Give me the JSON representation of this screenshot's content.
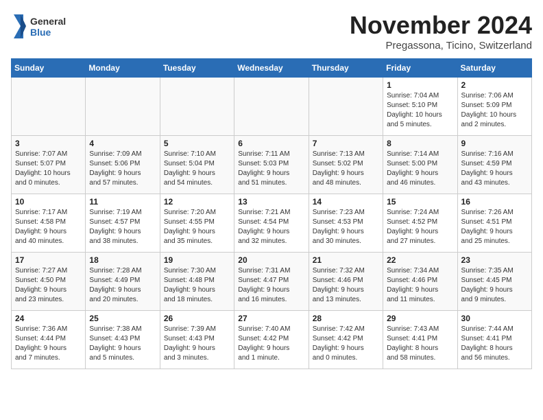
{
  "header": {
    "logo_general": "General",
    "logo_blue": "Blue",
    "month": "November 2024",
    "location": "Pregassona, Ticino, Switzerland"
  },
  "weekdays": [
    "Sunday",
    "Monday",
    "Tuesday",
    "Wednesday",
    "Thursday",
    "Friday",
    "Saturday"
  ],
  "weeks": [
    [
      {
        "day": "",
        "info": ""
      },
      {
        "day": "",
        "info": ""
      },
      {
        "day": "",
        "info": ""
      },
      {
        "day": "",
        "info": ""
      },
      {
        "day": "",
        "info": ""
      },
      {
        "day": "1",
        "info": "Sunrise: 7:04 AM\nSunset: 5:10 PM\nDaylight: 10 hours\nand 5 minutes."
      },
      {
        "day": "2",
        "info": "Sunrise: 7:06 AM\nSunset: 5:09 PM\nDaylight: 10 hours\nand 2 minutes."
      }
    ],
    [
      {
        "day": "3",
        "info": "Sunrise: 7:07 AM\nSunset: 5:07 PM\nDaylight: 10 hours\nand 0 minutes."
      },
      {
        "day": "4",
        "info": "Sunrise: 7:09 AM\nSunset: 5:06 PM\nDaylight: 9 hours\nand 57 minutes."
      },
      {
        "day": "5",
        "info": "Sunrise: 7:10 AM\nSunset: 5:04 PM\nDaylight: 9 hours\nand 54 minutes."
      },
      {
        "day": "6",
        "info": "Sunrise: 7:11 AM\nSunset: 5:03 PM\nDaylight: 9 hours\nand 51 minutes."
      },
      {
        "day": "7",
        "info": "Sunrise: 7:13 AM\nSunset: 5:02 PM\nDaylight: 9 hours\nand 48 minutes."
      },
      {
        "day": "8",
        "info": "Sunrise: 7:14 AM\nSunset: 5:00 PM\nDaylight: 9 hours\nand 46 minutes."
      },
      {
        "day": "9",
        "info": "Sunrise: 7:16 AM\nSunset: 4:59 PM\nDaylight: 9 hours\nand 43 minutes."
      }
    ],
    [
      {
        "day": "10",
        "info": "Sunrise: 7:17 AM\nSunset: 4:58 PM\nDaylight: 9 hours\nand 40 minutes."
      },
      {
        "day": "11",
        "info": "Sunrise: 7:19 AM\nSunset: 4:57 PM\nDaylight: 9 hours\nand 38 minutes."
      },
      {
        "day": "12",
        "info": "Sunrise: 7:20 AM\nSunset: 4:55 PM\nDaylight: 9 hours\nand 35 minutes."
      },
      {
        "day": "13",
        "info": "Sunrise: 7:21 AM\nSunset: 4:54 PM\nDaylight: 9 hours\nand 32 minutes."
      },
      {
        "day": "14",
        "info": "Sunrise: 7:23 AM\nSunset: 4:53 PM\nDaylight: 9 hours\nand 30 minutes."
      },
      {
        "day": "15",
        "info": "Sunrise: 7:24 AM\nSunset: 4:52 PM\nDaylight: 9 hours\nand 27 minutes."
      },
      {
        "day": "16",
        "info": "Sunrise: 7:26 AM\nSunset: 4:51 PM\nDaylight: 9 hours\nand 25 minutes."
      }
    ],
    [
      {
        "day": "17",
        "info": "Sunrise: 7:27 AM\nSunset: 4:50 PM\nDaylight: 9 hours\nand 23 minutes."
      },
      {
        "day": "18",
        "info": "Sunrise: 7:28 AM\nSunset: 4:49 PM\nDaylight: 9 hours\nand 20 minutes."
      },
      {
        "day": "19",
        "info": "Sunrise: 7:30 AM\nSunset: 4:48 PM\nDaylight: 9 hours\nand 18 minutes."
      },
      {
        "day": "20",
        "info": "Sunrise: 7:31 AM\nSunset: 4:47 PM\nDaylight: 9 hours\nand 16 minutes."
      },
      {
        "day": "21",
        "info": "Sunrise: 7:32 AM\nSunset: 4:46 PM\nDaylight: 9 hours\nand 13 minutes."
      },
      {
        "day": "22",
        "info": "Sunrise: 7:34 AM\nSunset: 4:46 PM\nDaylight: 9 hours\nand 11 minutes."
      },
      {
        "day": "23",
        "info": "Sunrise: 7:35 AM\nSunset: 4:45 PM\nDaylight: 9 hours\nand 9 minutes."
      }
    ],
    [
      {
        "day": "24",
        "info": "Sunrise: 7:36 AM\nSunset: 4:44 PM\nDaylight: 9 hours\nand 7 minutes."
      },
      {
        "day": "25",
        "info": "Sunrise: 7:38 AM\nSunset: 4:43 PM\nDaylight: 9 hours\nand 5 minutes."
      },
      {
        "day": "26",
        "info": "Sunrise: 7:39 AM\nSunset: 4:43 PM\nDaylight: 9 hours\nand 3 minutes."
      },
      {
        "day": "27",
        "info": "Sunrise: 7:40 AM\nSunset: 4:42 PM\nDaylight: 9 hours\nand 1 minute."
      },
      {
        "day": "28",
        "info": "Sunrise: 7:42 AM\nSunset: 4:42 PM\nDaylight: 9 hours\nand 0 minutes."
      },
      {
        "day": "29",
        "info": "Sunrise: 7:43 AM\nSunset: 4:41 PM\nDaylight: 8 hours\nand 58 minutes."
      },
      {
        "day": "30",
        "info": "Sunrise: 7:44 AM\nSunset: 4:41 PM\nDaylight: 8 hours\nand 56 minutes."
      }
    ]
  ],
  "colors": {
    "header_bg": "#2a6db5",
    "header_text": "#ffffff",
    "accent": "#2a6db5"
  }
}
